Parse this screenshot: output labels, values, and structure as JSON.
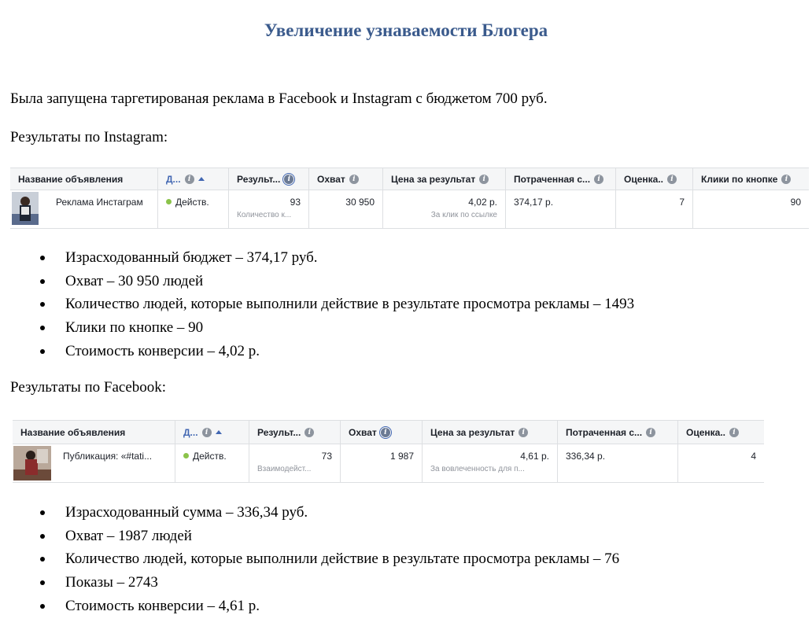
{
  "title": "Увеличение узнаваемости Блогера",
  "intro": "Была запущена таргетированая реклама в Facebook и Instagram с бюджетом 700 руб.",
  "instagram": {
    "heading": "Результаты по Instagram:",
    "table": {
      "headers": [
        "Название объявления",
        "Д...",
        "Результ...",
        "Охват",
        "Цена за результат",
        "Потраченная с...",
        "Оценка..",
        "Клики по кнопке"
      ],
      "row": {
        "name": "Реклама Инстаграм",
        "status": "Действ.",
        "results": "93",
        "results_sub": "Количество к...",
        "reach": "30 950",
        "cost": "4,02 р.",
        "cost_sub": "За клик по ссылке",
        "spent": "374,17 р.",
        "rating": "7",
        "clicks": "90"
      }
    },
    "bullets": [
      "Израсходованный бюджет – 374,17 руб.",
      "Охват – 30 950 людей",
      "Количество людей, которые выполнили действие в результате просмотра рекламы – 1493",
      "Клики по кнопке – 90",
      "Стоимость конверсии – 4,02 р."
    ]
  },
  "facebook": {
    "heading": "Результаты по Facebook:",
    "table": {
      "headers": [
        "Название объявления",
        "Д...",
        "Результ...",
        "Охват",
        "Цена за результат",
        "Потраченная с...",
        "Оценка.."
      ],
      "row": {
        "name": "Публикация: «#tati...",
        "status": "Действ.",
        "results": "73",
        "results_sub": "Взаимодейст...",
        "reach": "1 987",
        "cost": "4,61 р.",
        "cost_sub": "За вовлеченность для п...",
        "spent": "336,34 р.",
        "rating": "4"
      }
    },
    "bullets": [
      "Израсходованный сумма – 336,34 руб.",
      "Охват – 1987  людей",
      "Количество людей, которые выполнили действие в результате просмотра рекламы – 76",
      "Показы – 2743",
      "Стоимость конверсии – 4,61 р."
    ]
  },
  "icons": {
    "info": "info-icon",
    "sort": "sort-ascending-icon",
    "status": "status-active-dot-icon"
  },
  "colors": {
    "title": "#3a5a8c",
    "link_blue": "#4267b2",
    "status_green": "#8bc34a"
  }
}
